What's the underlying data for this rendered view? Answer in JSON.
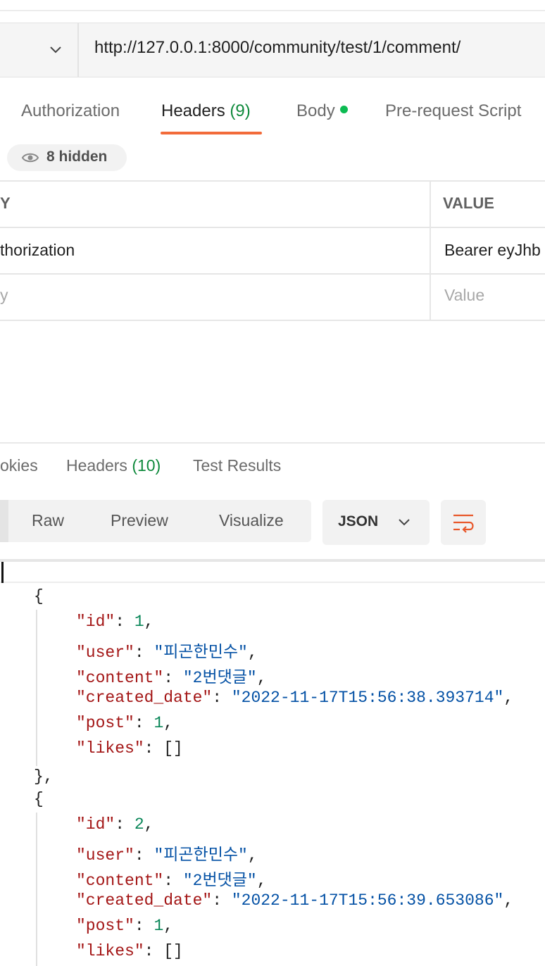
{
  "request": {
    "url": "http://127.0.0.1:8000/community/test/1/comment/",
    "tabs": [
      {
        "label": "Authorization"
      },
      {
        "label": "Headers",
        "count": "(9)"
      },
      {
        "label": "Body"
      },
      {
        "label": "Pre-request Script"
      }
    ],
    "hidden_badge": "8 hidden"
  },
  "headers_table": {
    "key_header": "Y",
    "value_header": "VALUE",
    "row_key": "thorization",
    "row_value": "Bearer eyJhb",
    "key_placeholder": "y",
    "value_placeholder": "Value"
  },
  "response": {
    "tabs": [
      {
        "label": "okies"
      },
      {
        "label": "Headers",
        "count": "(10)"
      },
      {
        "label": "Test Results"
      }
    ],
    "view_modes": [
      "Raw",
      "Preview",
      "Visualize"
    ],
    "format": "JSON",
    "items": [
      {
        "id": "1",
        "user": "\"피곤한민수\"",
        "content": "\"2번댓글\"",
        "created_date": "\"2022-11-17T15:56:38.393714\"",
        "post": "1",
        "likes": "[]"
      },
      {
        "id": "2",
        "user": "\"피곤한민수\"",
        "content": "\"2번댓글\"",
        "created_date": "\"2022-11-17T15:56:39.653086\"",
        "post": "1",
        "likes": "[]"
      }
    ],
    "keys": {
      "id": "\"id\"",
      "user": "\"user\"",
      "content": "\"content\"",
      "created_date": "\"created_date\"",
      "post": "\"post\"",
      "likes": "\"likes\""
    }
  },
  "colors": {
    "accent": "#f26b3a",
    "count_green": "#0f8a3c",
    "json_key": "#a31515",
    "json_string": "#0451a5",
    "json_number": "#098658"
  }
}
